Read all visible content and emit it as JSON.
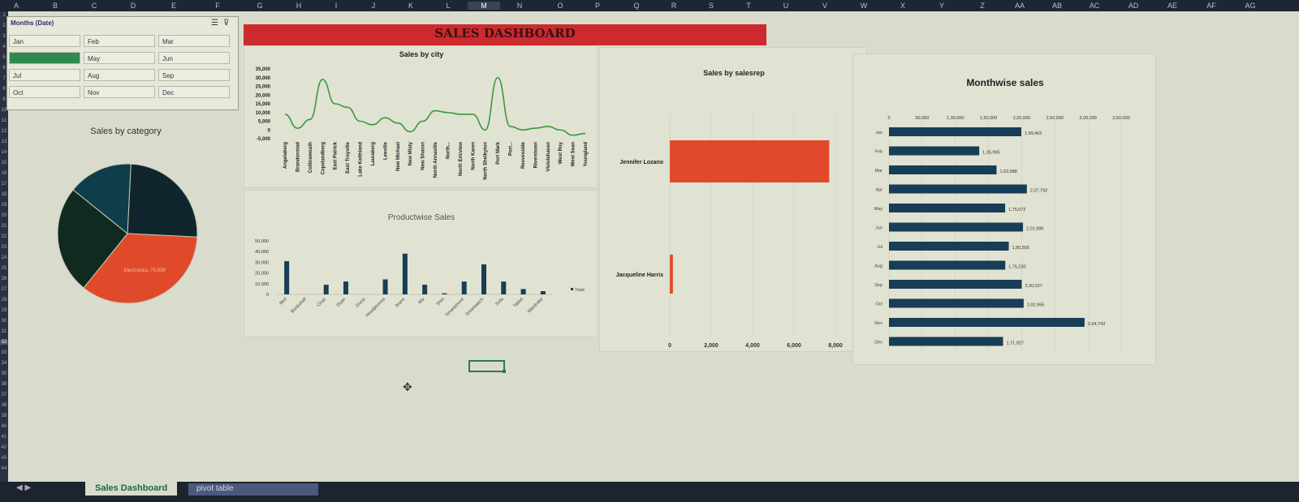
{
  "colors": {
    "accent_red": "#cc2a2d",
    "slicer_active": "#2e8a4e",
    "bar_dark": "#173d57",
    "line_green": "#3a9a3a",
    "pie_orange": "#e04a2a"
  },
  "columns": [
    "A",
    "B",
    "C",
    "D",
    "E",
    "F",
    "G",
    "H",
    "I",
    "J",
    "K",
    "L",
    "M",
    "N",
    "O",
    "P",
    "Q",
    "R",
    "S",
    "T",
    "U",
    "V",
    "W",
    "X",
    "Y",
    "Z",
    "AA",
    "AB",
    "AC",
    "AD",
    "AE",
    "AF",
    "AG"
  ],
  "selected_column": "M",
  "rows": [
    "1",
    "2",
    "3",
    "4",
    "5",
    "6",
    "7",
    "8",
    "9",
    "10",
    "11",
    "12",
    "13",
    "14",
    "15",
    "16",
    "17",
    "18",
    "19",
    "20",
    "21",
    "22",
    "23",
    "24",
    "25",
    "26",
    "27",
    "28",
    "29",
    "30",
    "31",
    "32",
    "33",
    "34",
    "35",
    "36",
    "37",
    "38",
    "39",
    "40",
    "41",
    "42",
    "43",
    "44"
  ],
  "selected_row": "32",
  "slicer": {
    "title": "Months (Date)",
    "icons": [
      "multi-select-icon",
      "clear-filter-icon"
    ],
    "months": [
      "Jan",
      "Feb",
      "Mar",
      "Apr",
      "May",
      "Jun",
      "Jul",
      "Aug",
      "Sep",
      "Oct",
      "Nov",
      "Dec"
    ],
    "active": "Apr"
  },
  "dashboard_title": "SALES DASHBOARD",
  "charts": {
    "category": {
      "title": "Sales by category",
      "chart_data": {
        "type": "pie",
        "slices": [
          {
            "label": "",
            "value": 25,
            "color": "#11252f"
          },
          {
            "label": "Electronics, 75,939",
            "value": 35,
            "color": "#e04a2a"
          },
          {
            "label": "",
            "value": 25,
            "color": "#102a1f"
          },
          {
            "label": "",
            "value": 15,
            "color": "#0f3d4c"
          }
        ]
      }
    },
    "city": {
      "title": "Sales by city",
      "chart_data": {
        "type": "line",
        "categories": [
          "Angelaberg",
          "Brandonstad",
          "Collinsmouth",
          "Copelandberg",
          "East Patrick",
          "East Troyville",
          "Lake Keithland",
          "Lauraberg",
          "Leeville",
          "New Michael",
          "New Misty",
          "New Sharon",
          "North Annaville",
          "North...",
          "North Ericview",
          "North Karen",
          "North Shelbyton",
          "Port Mark",
          "Port...",
          "Reevesside",
          "Riverstown",
          "Viviolehaven",
          "West Roy",
          "West Sean",
          "Youngland"
        ],
        "values": [
          9000,
          1000,
          6000,
          29000,
          15000,
          13000,
          5000,
          3000,
          7000,
          4000,
          -1000,
          5000,
          11000,
          10000,
          9000,
          9000,
          0,
          30000,
          2000,
          0,
          1000,
          2000,
          0,
          -3000,
          -2000
        ],
        "ytick_labels": [
          "35,000",
          "30,000",
          "25,000",
          "20,000",
          "15,000",
          "10,000",
          "5,000",
          "0",
          "-5,000"
        ],
        "ylim": [
          -5000,
          35000
        ]
      }
    },
    "product": {
      "title": "Productwise Sales",
      "legend": "Total",
      "chart_data": {
        "type": "bar",
        "categories": [
          "Bed",
          "Bookshelf",
          "Chair",
          "Dryer",
          "Dress",
          "Headphones",
          "Jeans",
          "Mix",
          "Shirt",
          "Smartphone",
          "Smartwatch",
          "Sofa",
          "Tablet",
          "Wardrobe"
        ],
        "values": [
          31000,
          0,
          9000,
          12000,
          0,
          14000,
          38000,
          9000,
          1000,
          12000,
          28000,
          12000,
          5000,
          3000
        ],
        "ytick_labels": [
          "50,000",
          "40,000",
          "30,000",
          "20,000",
          "10,000",
          "0"
        ],
        "ylim": [
          0,
          50000
        ]
      }
    },
    "salesrep": {
      "title": "Sales by salesrep",
      "chart_data": {
        "type": "bar",
        "categories": [
          "Jennifer Lozano",
          "Jacqueline Harris"
        ],
        "values": [
          7700,
          150
        ],
        "xtick_labels": [
          "0",
          "2,000",
          "4,000",
          "6,000",
          "8,000"
        ],
        "xlim": [
          0,
          8000
        ]
      }
    },
    "monthwise": {
      "title": "Monthwise sales",
      "chart_data": {
        "type": "bar",
        "categories": [
          "Jan",
          "Feb",
          "Mar",
          "Apr",
          "May",
          "Jun",
          "Jul",
          "Aug",
          "Sep",
          "Oct",
          "Nov",
          "Dec"
        ],
        "values": [
          199402,
          135995,
          162088,
          207792,
          175072,
          201986,
          180556,
          175230,
          200027,
          202995,
          294743,
          171927
        ],
        "data_labels": [
          "1,99,402",
          "1,35,995",
          "1,62,088",
          "2,07,792",
          "1,75,072",
          "2,01,986",
          "1,80,556",
          "1,75,230",
          "2,00,027",
          "2,02,995",
          "2,94,743",
          "1,71,927"
        ],
        "xtick_labels": [
          "0",
          "50,000",
          "1,00,000",
          "1,50,000",
          "2,00,000",
          "2,50,000",
          "3,00,000",
          "3,50,000"
        ],
        "xlim": [
          0,
          350000
        ]
      }
    }
  },
  "sheet_tabs": {
    "active": "Sales Dashboard",
    "second": "pivot table"
  }
}
